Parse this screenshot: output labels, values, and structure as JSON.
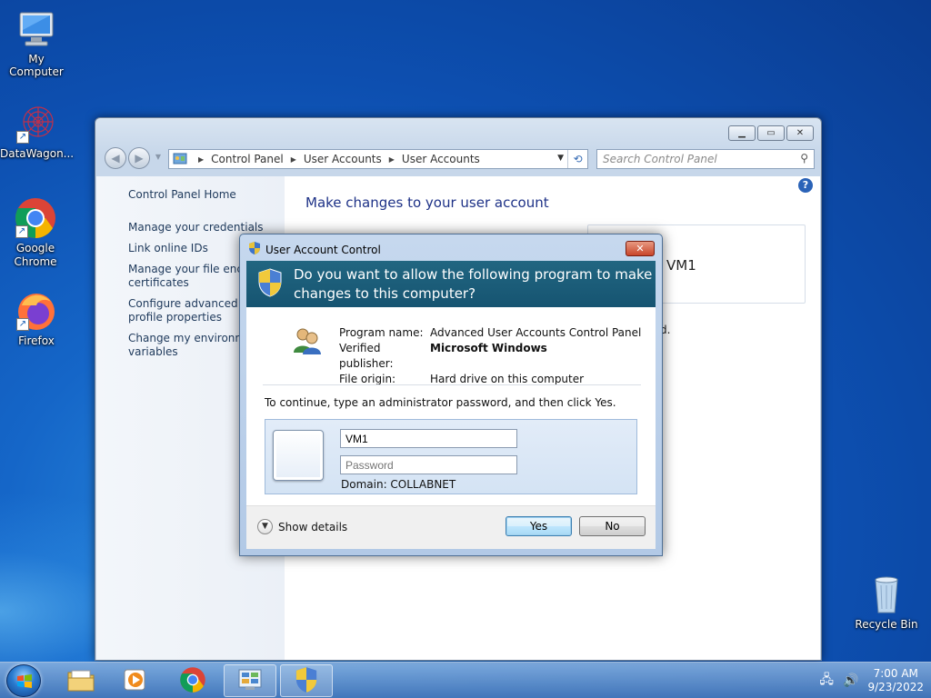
{
  "desktop": {
    "icons": [
      {
        "label": "My Computer"
      },
      {
        "label": "DataWagon..."
      },
      {
        "label": "Google Chrome"
      },
      {
        "label": "Firefox"
      },
      {
        "label": "Recycle Bin"
      }
    ]
  },
  "control_panel": {
    "breadcrumb": [
      "Control Panel",
      "User Accounts",
      "User Accounts"
    ],
    "search_placeholder": "Search Control Panel",
    "sidebar": [
      "Control Panel Home",
      "Manage your credentials",
      "Link online IDs",
      "Manage your file encry",
      "certificates",
      "Configure advanced us",
      "profile properties",
      "Change my environme",
      "variables"
    ],
    "title": "Make changes to your user account",
    "account_name": "VM1",
    "partial_text": "d."
  },
  "uac": {
    "window_title": "User Account Control",
    "question_line1": "Do you want to allow the following program to make",
    "question_line2": "changes to this computer?",
    "program_name_label": "Program name:",
    "program_name": "Advanced User Accounts Control Panel",
    "publisher_label": "Verified publisher:",
    "publisher": "Microsoft Windows",
    "origin_label": "File origin:",
    "origin": "Hard drive on this computer",
    "instruction": "To continue, type an administrator password, and then click Yes.",
    "username_value": "VM1",
    "password_placeholder": "Password",
    "domain": "Domain: COLLABNET",
    "show_details": "Show details",
    "yes_label": "Yes",
    "no_label": "No"
  },
  "taskbar": {
    "time": "7:00 AM",
    "date": "9/23/2022"
  },
  "colors": {
    "uac_banner": "#1b5c79",
    "link": "#1e395b",
    "title_blue": "#1e3287"
  }
}
